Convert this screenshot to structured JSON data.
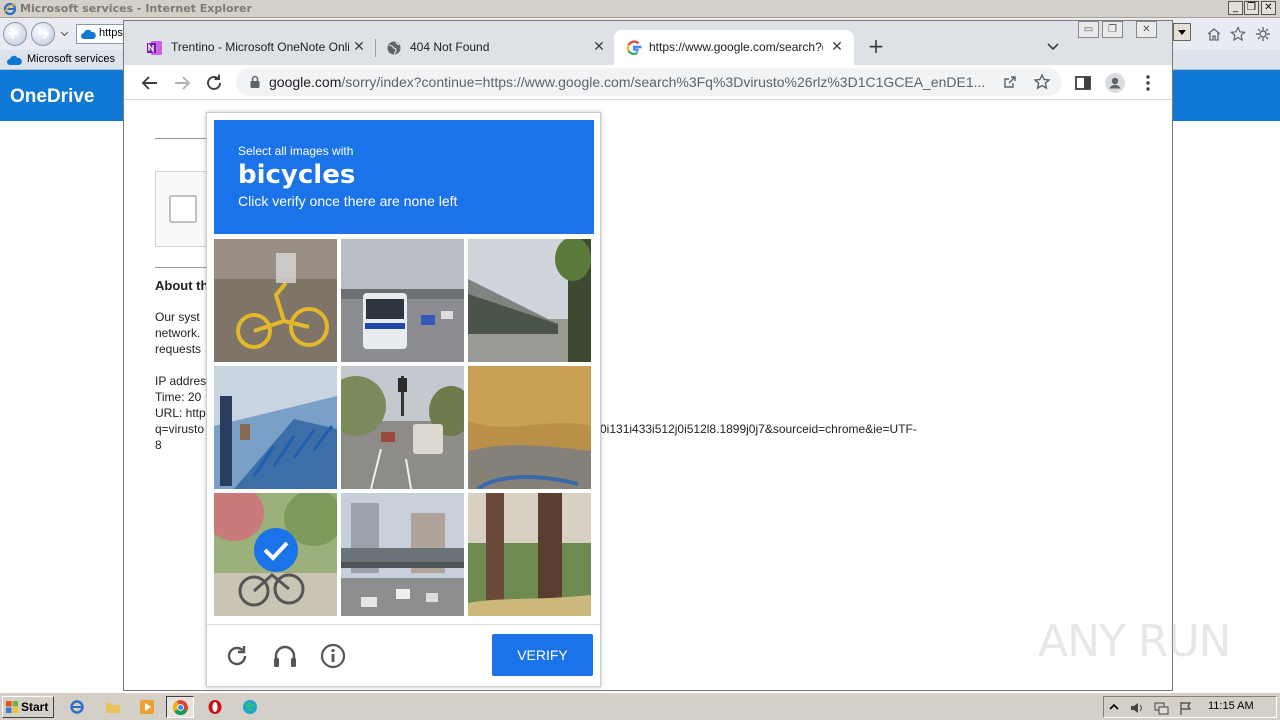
{
  "ie": {
    "title": "Microsoft services - Internet Explorer",
    "address_value": "https:",
    "tab_title": "Microsoft services",
    "onedrive_title": "OneDrive"
  },
  "chrome": {
    "tabs": [
      {
        "title": "Trentino - Microsoft OneNote Online",
        "icon": "onenote-icon"
      },
      {
        "title": "404 Not Found",
        "icon": "globe-icon"
      },
      {
        "title": "https://www.google.com/search?q=",
        "icon": "google-icon"
      }
    ],
    "url_host": "google.com",
    "url_path": "/sorry/index?continue=https://www.google.com/search%3Fq%3Dvirusto%26rlz%3D1C1GCEA_enDE1..."
  },
  "page": {
    "about_heading": "About th",
    "para_line1": "Our syst",
    "para_line2": "network.",
    "para_line3": "requests",
    "ip_label": "IP addres",
    "time_label": "Time: 20",
    "url_label": "URL: http",
    "url_line2": "q=virusto",
    "url_line3": "8",
    "url_tail": "0i131i433i512j0i512l8.1899j0j7&sourceid=chrome&ie=UTF-"
  },
  "captcha": {
    "instruction_small": "Select all images with",
    "target": "bicycles",
    "instruction_sub": "Click verify once there are none left",
    "tiles": [
      {
        "subject": "yellow bicycle lying on pavement",
        "selected": false
      },
      {
        "subject": "city bus on highway",
        "selected": false
      },
      {
        "subject": "station canopy and trees",
        "selected": false
      },
      {
        "subject": "bike share docking station",
        "selected": false
      },
      {
        "subject": "cars on street with traffic light",
        "selected": false
      },
      {
        "subject": "dry grass field",
        "selected": false
      },
      {
        "subject": "person riding bicycle on path",
        "selected": true
      },
      {
        "subject": "highway overpass and buildings",
        "selected": false
      },
      {
        "subject": "tree trunks and grass",
        "selected": false
      }
    ],
    "verify_label": "VERIFY",
    "footer_icons": [
      "reload-icon",
      "audio-headphones-icon",
      "info-icon"
    ]
  },
  "watermark": "ANY RUN",
  "taskbar": {
    "start_label": "Start",
    "clock": "11:15 AM"
  },
  "colors": {
    "captcha_blue": "#1a73e8",
    "onedrive_blue": "#0f78d4",
    "chrome_tabstrip": "#dee1e6"
  }
}
